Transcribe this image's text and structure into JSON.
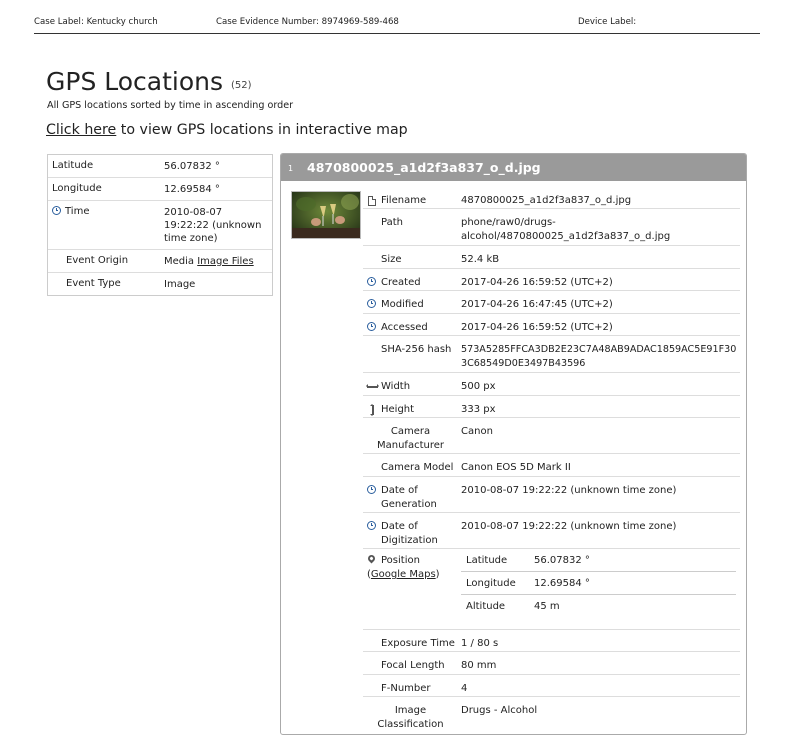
{
  "header": {
    "case_label": "Case Label: Kentucky church",
    "case_evidence": "Case Evidence Number: 8974969-589-468",
    "device_label": "Device Label:"
  },
  "page": {
    "title": "GPS Locations",
    "count": "(52)",
    "subtitle": "All GPS locations sorted by time in ascending order",
    "map_link": "Click here",
    "map_link_rest": " to view GPS locations in interactive map"
  },
  "location": {
    "latitude_label": "Latitude",
    "latitude": "56.07832 °",
    "longitude_label": "Longitude",
    "longitude": "12.69584 °",
    "time_label": "Time",
    "time": "2010-08-07 19:22:22 (unknown time zone)",
    "event_origin_label": "Event Origin",
    "event_origin_prefix": "Media ",
    "event_origin_link": "Image Files",
    "event_type_label": "Event Type",
    "event_type": "Image"
  },
  "file": {
    "index": "1",
    "name": "4870800025_a1d2f3a837_o_d.jpg",
    "props": {
      "filename_label": "Filename",
      "filename": "4870800025_a1d2f3a837_o_d.jpg",
      "path_label": "Path",
      "path": "phone/raw0/drugs-alcohol/4870800025_a1d2f3a837_o_d.jpg",
      "size_label": "Size",
      "size": "52.4 kB",
      "created_label": "Created",
      "created": "2017-04-26 16:59:52 (UTC+2)",
      "modified_label": "Modified",
      "modified": "2017-04-26 16:47:45 (UTC+2)",
      "accessed_label": "Accessed",
      "accessed": "2017-04-26 16:59:52 (UTC+2)",
      "sha_label": "SHA-256 hash",
      "sha": "573A5285FFCA3DB2E23C7A48AB9ADAC1859AC5E91F303C68549D0E3497B43596",
      "width_label": "Width",
      "width": "500 px",
      "height_label": "Height",
      "height": "333 px",
      "camera_manufacturer_label": "Camera Manufacturer",
      "camera_manufacturer": "Canon",
      "camera_model_label": "Camera Model",
      "camera_model": "Canon EOS 5D Mark II",
      "date_generation_label": "Date of Generation",
      "date_generation": "2010-08-07 19:22:22 (unknown time zone)",
      "date_digitization_label": "Date of Digitization",
      "date_digitization": "2010-08-07 19:22:22 (unknown time zone)",
      "position_label": "Position",
      "position_link": "Google Maps",
      "position": {
        "latitude_label": "Latitude",
        "latitude": "56.07832 °",
        "longitude_label": "Longitude",
        "longitude": "12.69584 °",
        "altitude_label": "Altitude",
        "altitude": "45 m"
      },
      "exposure_label": "Exposure Time",
      "exposure": "1 / 80 s",
      "focal_label": "Focal Length",
      "focal": "80 mm",
      "fnumber_label": "F-Number",
      "fnumber": "4",
      "classification_label": "Image Classification",
      "classification": "Drugs - Alcohol"
    }
  },
  "colors": {
    "icon_blue": "#2b5f9e",
    "card_header": "#9a9a9a"
  }
}
